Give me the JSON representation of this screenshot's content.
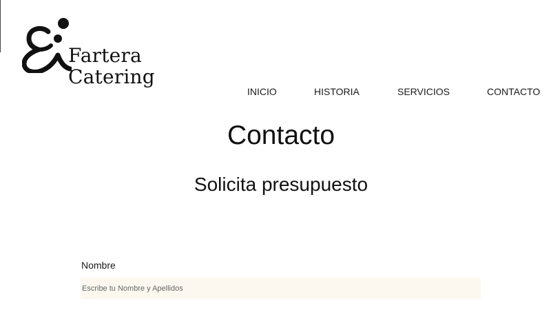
{
  "brand": {
    "line1": "Fartera",
    "line2": "Catering"
  },
  "nav": {
    "items": [
      {
        "label": "INICIO"
      },
      {
        "label": "HISTORIA"
      },
      {
        "label": "SERVICIOS"
      },
      {
        "label": "CONTACTO"
      }
    ]
  },
  "main": {
    "title": "Contacto",
    "subtitle": "Solicita presupuesto"
  },
  "form": {
    "name_label": "Nombre",
    "name_value": "",
    "name_placeholder": "Escribe tu Nombre y Apellidos"
  },
  "colors": {
    "text": "#111111",
    "input_background": "#fcf8ef",
    "background": "#ffffff"
  }
}
